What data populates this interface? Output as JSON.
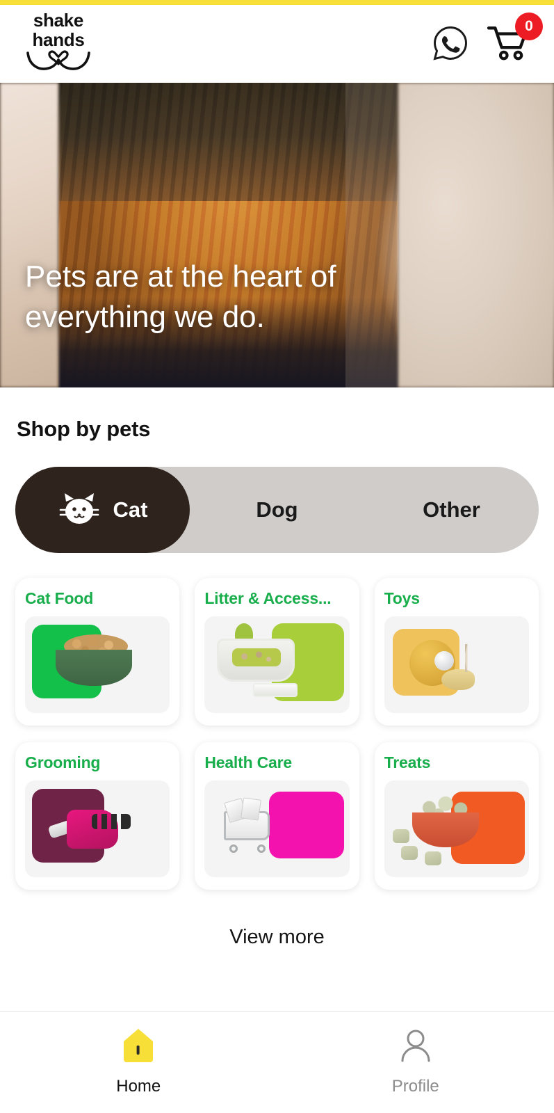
{
  "brand": {
    "accent_bar_color": "#F7DF37",
    "logo_line1": "shake",
    "logo_line2": "hands",
    "logo_mark": "heart-swoosh"
  },
  "header": {
    "whatsapp_icon": "whatsapp-icon",
    "cart_icon": "shopping-cart-icon",
    "cart_count": "0",
    "cart_badge_color": "#ED1C24"
  },
  "hero": {
    "headline": "Pets are at the heart of everything we do.",
    "image_subject": "orange-tabby-cat"
  },
  "shop": {
    "title": "Shop by pets",
    "tabs": [
      {
        "label": "Cat",
        "icon": "cat-face-icon",
        "active": true
      },
      {
        "label": "Dog",
        "icon": "",
        "active": false
      },
      {
        "label": "Other",
        "icon": "",
        "active": false
      }
    ],
    "active_tab_bg": "#2E241D",
    "track_bg": "#CFCCCA",
    "category_title_color": "#18AE4B",
    "categories": [
      {
        "label": "Cat Food",
        "swatch": "#13C04A",
        "art": "food-bowl"
      },
      {
        "label": "Litter & Access...",
        "swatch": "#A8CE3A",
        "art": "litter-box"
      },
      {
        "label": "Toys",
        "swatch": "#EFC25B",
        "art": "toy-ball"
      },
      {
        "label": "Grooming",
        "swatch": "#6E2347",
        "art": "grooming-glove"
      },
      {
        "label": "Health Care",
        "swatch": "#F312AE",
        "art": "health-cart"
      },
      {
        "label": "Treats",
        "swatch": "#F15A22",
        "art": "treat-bowl"
      }
    ],
    "view_more": "View more"
  },
  "bottom_nav": {
    "items": [
      {
        "label": "Home",
        "icon": "home-icon",
        "active": true,
        "color": "#F7DF37"
      },
      {
        "label": "Profile",
        "icon": "person-icon",
        "active": false,
        "color": "#8C8C8C"
      }
    ]
  }
}
